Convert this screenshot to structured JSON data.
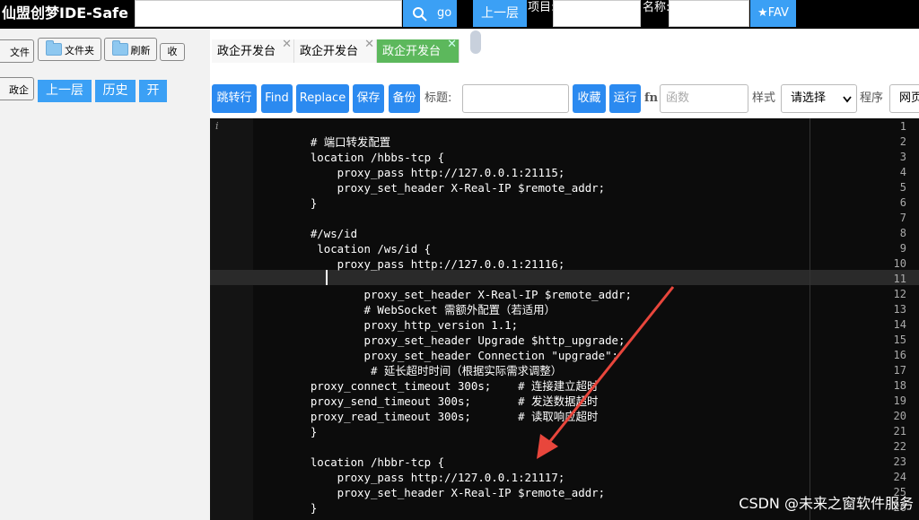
{
  "app_title": "仙盟创梦IDE-Safe",
  "top": {
    "go_label": "go",
    "up_label": "上一层",
    "project_label": "项目:",
    "name_label": "名称:",
    "fav_label": "★FAV"
  },
  "left": {
    "file_label": "文件",
    "folder_label": "文件夹",
    "refresh_label": "刷新",
    "collapse_label": "收",
    "gov_label": "政企",
    "up_label": "上一层",
    "history_label": "历史",
    "open_label": "开"
  },
  "tabs": [
    {
      "label": "政企开发台"
    },
    {
      "label": "政企开发台"
    },
    {
      "label": "政企开发台",
      "active": true
    }
  ],
  "toolbar": {
    "jump_label": "跳转行",
    "find_label": "Find",
    "replace_label": "Replace",
    "save_label": "保存",
    "backup_label": "备份",
    "title_label": "标题:",
    "collect_label": "收藏",
    "run_label": "运行",
    "fn_label": "fn",
    "func_placeholder": "函数",
    "style_label": "样式",
    "style_selected": "请选择",
    "program_label": "程序",
    "program_value": "网页"
  },
  "editor": {
    "info_icon": "i",
    "lines": [
      {
        "n": "1",
        "t": ""
      },
      {
        "n": "2",
        "t": "    # 端口转发配置"
      },
      {
        "n": "3",
        "t": "    location /hbbs-tcp {"
      },
      {
        "n": "4",
        "t": "        proxy_pass http://127.0.0.1:21115;"
      },
      {
        "n": "5",
        "t": "        proxy_set_header X-Real-IP $remote_addr;"
      },
      {
        "n": "6",
        "t": "    }"
      },
      {
        "n": "7",
        "t": ""
      },
      {
        "n": "8",
        "t": "    #/ws/id"
      },
      {
        "n": "9",
        "t": "     location /ws/id {"
      },
      {
        "n": "10",
        "t": "        proxy_pass http://127.0.0.1:21116;"
      },
      {
        "n": "11",
        "t": ""
      },
      {
        "n": "12",
        "t": "            proxy_set_header X-Real-IP $remote_addr;"
      },
      {
        "n": "13",
        "t": "            # WebSocket 需额外配置（若适用）"
      },
      {
        "n": "14",
        "t": "            proxy_http_version 1.1;"
      },
      {
        "n": "15",
        "t": "            proxy_set_header Upgrade $http_upgrade;"
      },
      {
        "n": "16",
        "t": "            proxy_set_header Connection \"upgrade\";"
      },
      {
        "n": "17",
        "t": "             # 延长超时时间（根据实际需求调整）"
      },
      {
        "n": "18",
        "t": "    proxy_connect_timeout 300s;    # 连接建立超时"
      },
      {
        "n": "19",
        "t": "    proxy_send_timeout 300s;       # 发送数据超时"
      },
      {
        "n": "20",
        "t": "    proxy_read_timeout 300s;       # 读取响应超时"
      },
      {
        "n": "21",
        "t": "    }"
      },
      {
        "n": "22",
        "t": ""
      },
      {
        "n": "23",
        "t": "    location /hbbr-tcp {"
      },
      {
        "n": "24",
        "t": "        proxy_pass http://127.0.0.1:21117;"
      },
      {
        "n": "25",
        "t": "        proxy_set_header X-Real-IP $remote_addr;"
      },
      {
        "n": "26",
        "t": "    }"
      }
    ]
  },
  "watermark": "CSDN @未来之窗软件服务",
  "colors": {
    "accent": "#2b8af0",
    "active_tab": "#5cb85c",
    "arrow": "#e8463c"
  }
}
